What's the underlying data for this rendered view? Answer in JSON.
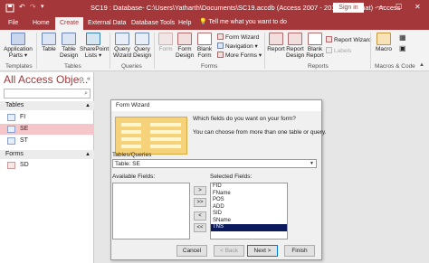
{
  "titlebar": {
    "title": "SC19 : Database- C:\\Users\\Yatharth\\Documents\\SC19.accdb (Access 2007 - 2016 file format) - Access",
    "sign_in": "Sign in",
    "minimize": "—",
    "maximize": "☐",
    "close": "✕",
    "accent_color": "#a4373a"
  },
  "tabs": [
    "File",
    "Home",
    "Create",
    "External Data",
    "Database Tools",
    "Help"
  ],
  "active_tab": "Create",
  "tell_me": "Tell me what you want to do",
  "ribbon": {
    "templates": {
      "app_parts": "Application Parts ▾",
      "group": "Templates"
    },
    "tables": {
      "table": "Table",
      "table_design": "Table Design",
      "sharepoint": "SharePoint Lists ▾",
      "group": "Tables"
    },
    "queries": {
      "query_wizard": "Query Wizard",
      "query_design": "Query Design",
      "group": "Queries"
    },
    "forms": {
      "form": "Form",
      "form_design": "Form Design",
      "blank_form": "Blank Form",
      "form_wizard": "Form Wizard",
      "navigation": "Navigation ▾",
      "more_forms": "More Forms ▾",
      "group": "Forms"
    },
    "reports": {
      "report": "Report",
      "report_design": "Report Design",
      "blank_report": "Blank Report",
      "report_wizard": "Report Wizard",
      "labels": "Labels",
      "group": "Reports"
    },
    "macros": {
      "macro": "Macro",
      "group": "Macros & Code"
    }
  },
  "nav": {
    "title": "All Access Obje...",
    "tables_header": "Tables",
    "tables": [
      "FI",
      "SE",
      "ST"
    ],
    "selected_table": "SE",
    "forms_header": "Forms",
    "forms": [
      "SD"
    ]
  },
  "dialog": {
    "title": "Form Wizard",
    "question1": "Which fields do you want on your form?",
    "question2": "You can choose from more than one table or query.",
    "tables_queries_label": "Tables/Queries",
    "table_value": "Table: SE",
    "available_label": "Available Fields:",
    "selected_label": "Selected Fields:",
    "selected_fields": [
      "FID",
      "FName",
      "POS",
      "ADD",
      "SID",
      "SName",
      "TNS"
    ],
    "selected_field": "TNS",
    "move_buttons": [
      ">",
      ">>",
      "<",
      "<<"
    ],
    "buttons": {
      "cancel": "Cancel",
      "back": "< Back",
      "next": "Next >",
      "finish": "Finish"
    }
  }
}
